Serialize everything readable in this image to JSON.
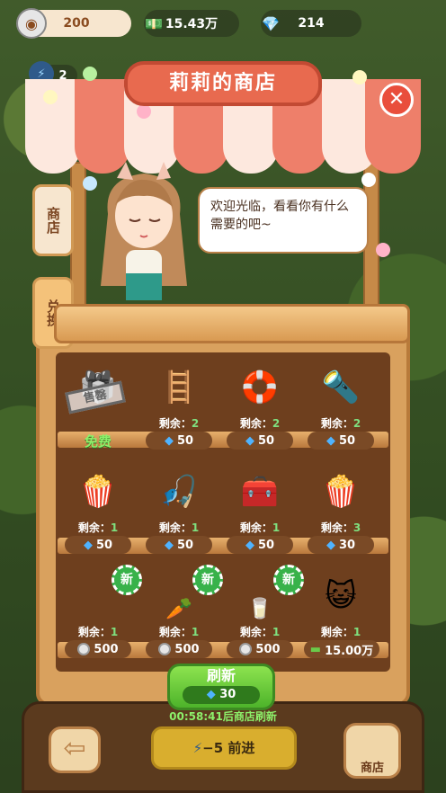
{
  "resources": {
    "coins": "200",
    "cash": "15.43万",
    "gems": "214",
    "energy": "2"
  },
  "shop": {
    "title": "莉莉的商店",
    "close_glyph": "✕",
    "tabs": [
      {
        "label": "商店"
      },
      {
        "label": "兑换"
      }
    ],
    "greeting": "欢迎光临，看看你有什么需要的吧~",
    "shelf1": [
      {
        "name": "gift-box",
        "glyph": "🎁",
        "sold_stamp": "售罄",
        "free_label": "免费"
      },
      {
        "name": "ladder",
        "glyph": "🪜",
        "remain_label": "剩余：",
        "remain": "2",
        "price": "50"
      },
      {
        "name": "life-ring",
        "glyph": "🛟",
        "remain_label": "剩余：",
        "remain": "2",
        "price": "50"
      },
      {
        "name": "flashlight",
        "glyph": "🔦",
        "remain_label": "剩余：",
        "remain": "2",
        "price": "50"
      }
    ],
    "shelf2": [
      {
        "name": "popcorn-bowl",
        "glyph": "🍿",
        "remain_label": "剩余：",
        "remain": "1",
        "price": "50"
      },
      {
        "name": "cat-toy",
        "glyph": "🎣",
        "remain_label": "剩余：",
        "remain": "1",
        "price": "50"
      },
      {
        "name": "first-aid-kit",
        "glyph": "🧰",
        "remain_label": "剩余：",
        "remain": "1",
        "price": "50"
      },
      {
        "name": "popcorn-bowl-2",
        "glyph": "🍿",
        "remain_label": "剩余：",
        "remain": "3",
        "price": "30"
      }
    ],
    "shelf3": [
      {
        "name": "new-item-1",
        "glyph": "",
        "new_label": "新",
        "remain_label": "剩余：",
        "remain": "1",
        "price": "500"
      },
      {
        "name": "carrot",
        "glyph": "🥕",
        "new_label": "新",
        "remain_label": "剩余：",
        "remain": "1",
        "price": "500"
      },
      {
        "name": "milk",
        "glyph": "🥛",
        "new_label": "新",
        "remain_label": "剩余：",
        "remain": "1",
        "price": "500"
      },
      {
        "name": "cat-ball",
        "glyph": "😺",
        "remain_label": "剩余：",
        "remain": "1",
        "price": "15.00万"
      }
    ],
    "refresh": {
      "label": "刷新",
      "cost": "30",
      "timer": "00:58:41后商店刷新"
    }
  },
  "bottom": {
    "back_glyph": "⇦",
    "go_label": "−5 前进",
    "shop_label": "商店"
  },
  "colors": {
    "awning_red": "#ee7f6a",
    "awning_white": "#fde8de",
    "accent_green": "#4db32a",
    "gem_blue": "#4fb3ff"
  }
}
